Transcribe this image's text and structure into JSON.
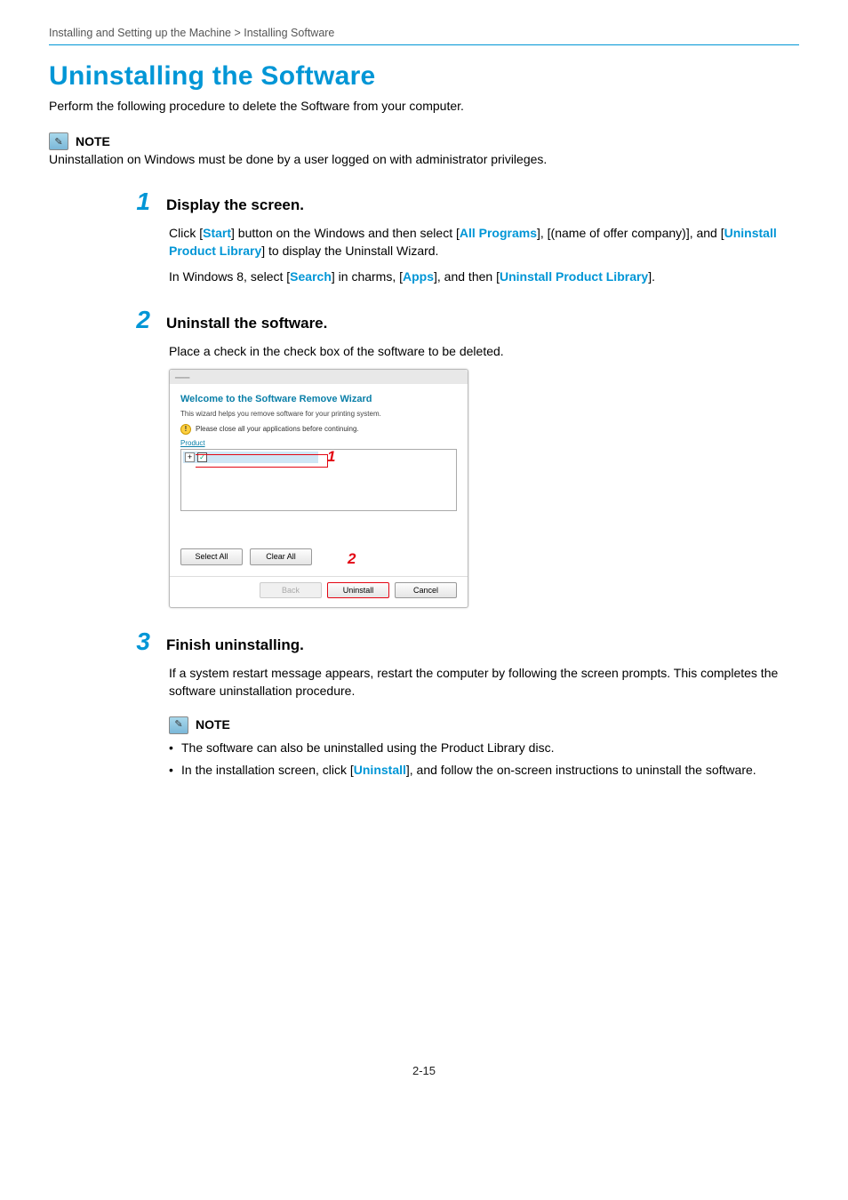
{
  "breadcrumb": "Installing and Setting up the Machine > Installing Software",
  "h1": "Uninstalling the Software",
  "intro": "Perform the following procedure to delete the Software from your computer.",
  "note_top": {
    "label": "NOTE",
    "text": "Uninstallation on Windows must be done by a user logged on with administrator privileges."
  },
  "steps": {
    "s1": {
      "num": "1",
      "title": "Display the screen.",
      "p1a": "Click [",
      "p1b": "Start",
      "p1c": "] button on the Windows and then select [",
      "p1d": "All Programs",
      "p1e": "], [(name of offer company)], and [",
      "p1f": "Uninstall Product Library",
      "p1g": "] to display the Uninstall Wizard.",
      "p2a": "In Windows 8, select [",
      "p2b": "Search",
      "p2c": "] in charms, [",
      "p2d": "Apps",
      "p2e": "], and then [",
      "p2f": "Uninstall Product Library",
      "p2g": "]."
    },
    "s2": {
      "num": "2",
      "title": "Uninstall the software.",
      "p1": "Place a check in the check box of the software to be deleted."
    },
    "s3": {
      "num": "3",
      "title": "Finish uninstalling.",
      "p1": "If a system restart message appears, restart the computer by following the screen prompts. This completes the software uninstallation procedure."
    }
  },
  "wizard": {
    "heading": "Welcome to the Software Remove Wizard",
    "sub": "This wizard helps you remove software for your printing system.",
    "warn": "Please close all your applications before continuing.",
    "panel_label": "Product",
    "callout1": "1",
    "callout2": "2",
    "select_all": "Select All",
    "clear_all": "Clear All",
    "back": "Back",
    "uninstall": "Uninstall",
    "cancel": "Cancel"
  },
  "note_bottom": {
    "label": "NOTE",
    "li1": "The software can also be uninstalled using the Product Library disc.",
    "li2a": "In the installation screen, click [",
    "li2b": "Uninstall",
    "li2c": "], and follow the on-screen instructions to uninstall the software."
  },
  "page_number": "2-15"
}
